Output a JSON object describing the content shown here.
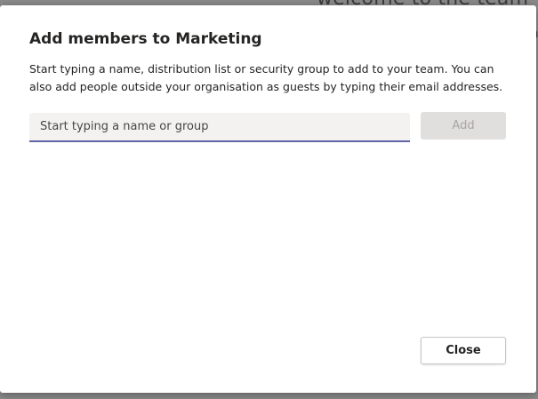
{
  "background": {
    "peek_text": "welcome to the team",
    "peek_small": "a"
  },
  "dialog": {
    "title": "Add members to Marketing",
    "description": "Start typing a name, distribution list or security group to add to your team. You can also add people outside your organisation as guests by typing their email addresses.",
    "search": {
      "placeholder": "Start typing a name or group",
      "value": ""
    },
    "add_label": "Add",
    "close_label": "Close"
  },
  "colors": {
    "accent": "#6264a7",
    "disabled_bg": "#e1dfdd",
    "disabled_text": "#a8a6a4"
  }
}
